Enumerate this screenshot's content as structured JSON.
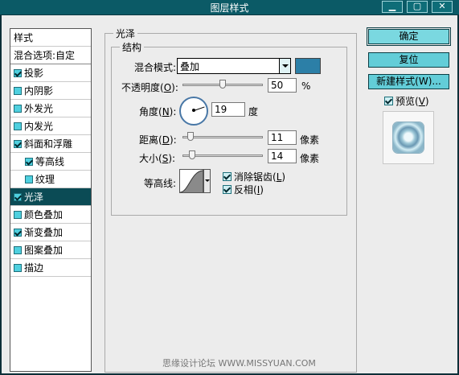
{
  "window": {
    "title": "图层样式",
    "min_glyph": "▁",
    "max_glyph": "▢",
    "close_glyph": "✕"
  },
  "left_panel": {
    "header": "样式",
    "blending": "混合选项:自定",
    "items": [
      {
        "label": "投影",
        "checked": true,
        "selected": false,
        "indent": false
      },
      {
        "label": "内阴影",
        "checked": false,
        "selected": false,
        "indent": false
      },
      {
        "label": "外发光",
        "checked": false,
        "selected": false,
        "indent": false
      },
      {
        "label": "内发光",
        "checked": false,
        "selected": false,
        "indent": false
      },
      {
        "label": "斜面和浮雕",
        "checked": true,
        "selected": false,
        "indent": false
      },
      {
        "label": "等高线",
        "checked": true,
        "selected": false,
        "indent": true
      },
      {
        "label": "纹理",
        "checked": false,
        "selected": false,
        "indent": true
      },
      {
        "label": "光泽",
        "checked": true,
        "selected": true,
        "indent": false
      },
      {
        "label": "颜色叠加",
        "checked": false,
        "selected": false,
        "indent": false
      },
      {
        "label": "渐变叠加",
        "checked": true,
        "selected": false,
        "indent": false
      },
      {
        "label": "图案叠加",
        "checked": false,
        "selected": false,
        "indent": false
      },
      {
        "label": "描边",
        "checked": false,
        "selected": false,
        "indent": false
      }
    ]
  },
  "satin": {
    "group_title": "光泽",
    "structure_title": "结构",
    "blend_mode_label": "混合模式:",
    "blend_mode_value": "叠加",
    "blend_color": "#2c7fa7",
    "opacity_label_pre": "不透明度(",
    "opacity_key": "O",
    "opacity_label_post": "):",
    "opacity_value": "50",
    "opacity_unit": "%",
    "angle_label_pre": "角度(",
    "angle_key": "N",
    "angle_label_post": "):",
    "angle_value": "19",
    "angle_unit": "度",
    "distance_label_pre": "距离(",
    "distance_key": "D",
    "distance_label_post": "):",
    "distance_value": "11",
    "distance_unit": "像素",
    "size_label_pre": "大小(",
    "size_key": "S",
    "size_label_post": "):",
    "size_value": "14",
    "size_unit": "像素",
    "contour_label": "等高线:",
    "anti_alias_pre": "消除锯齿(",
    "anti_alias_key": "L",
    "anti_alias_post": ")",
    "anti_alias_checked": true,
    "invert_pre": "反相(",
    "invert_key": "I",
    "invert_post": ")",
    "invert_checked": true
  },
  "buttons": {
    "ok": "确定",
    "reset": "复位",
    "new_style": "新建样式(W)...",
    "preview_pre": "预览(",
    "preview_key": "V",
    "preview_post": ")",
    "preview_checked": true
  },
  "watermark": "思缘设计论坛 WWW.MISSYUAN.COM"
}
